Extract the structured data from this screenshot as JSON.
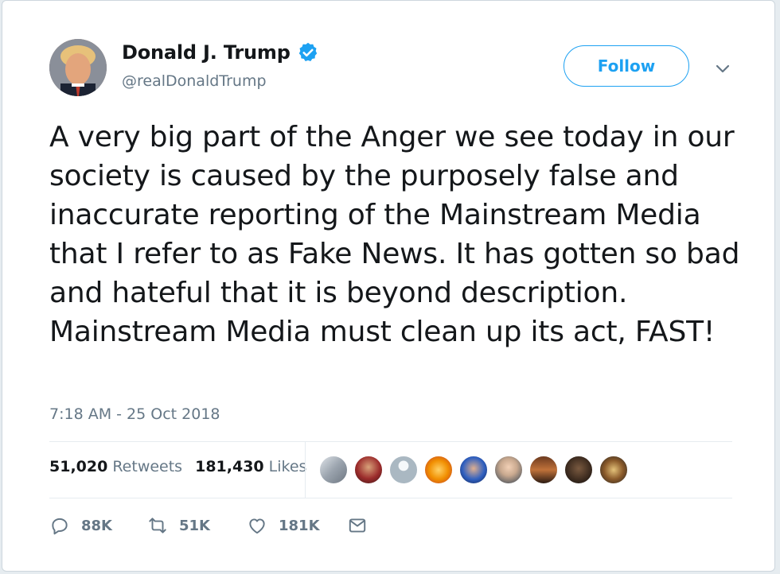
{
  "user": {
    "display_name": "Donald J. Trump",
    "handle": "@realDonaldTrump",
    "verified": true
  },
  "follow_button": {
    "label": "Follow"
  },
  "tweet": {
    "text": "A very big part of the Anger we see today in our society is caused by the purposely false and inaccurate reporting of the Mainstream Media that I refer to as Fake News. It has gotten so bad and hateful that it is beyond description. Mainstream Media must clean up its act, FAST!",
    "timestamp": "7:18 AM - 25 Oct 2018"
  },
  "stats": {
    "retweets_count": "51,020",
    "retweets_label": "Retweets",
    "likes_count": "181,430",
    "likes_label": "Likes"
  },
  "actions": {
    "replies": "88K",
    "retweets": "51K",
    "likes": "181K"
  },
  "colors": {
    "accent": "#1da1f2",
    "muted": "#657786",
    "text": "#14171a"
  },
  "icons": [
    "verified-badge-icon",
    "chevron-down-icon",
    "reply-icon",
    "retweet-icon",
    "like-icon",
    "message-icon"
  ]
}
